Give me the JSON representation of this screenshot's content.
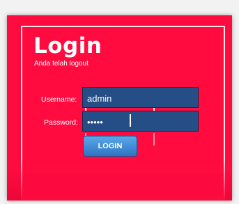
{
  "login": {
    "title": "Login",
    "subtitle": "Anda telah logout",
    "username_label": "Username:",
    "username_value": "admin",
    "password_label": "Password:",
    "password_value": "•••••",
    "button_label": "LOGIN"
  },
  "colors": {
    "panel": "#ff0b40",
    "input": "#254d86",
    "button": "#3c89d6"
  }
}
